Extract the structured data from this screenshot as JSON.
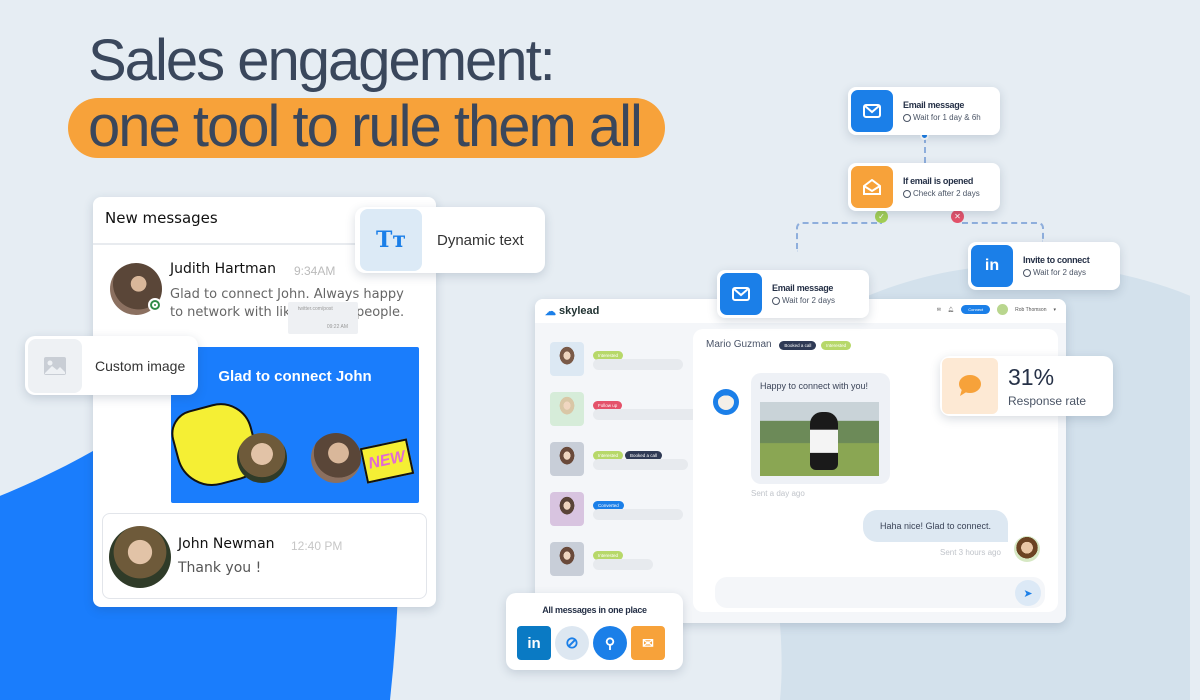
{
  "hero": {
    "line1": "Sales engagement:",
    "line2": "one tool to rule them all"
  },
  "colors": {
    "accent_blue": "#1b7fe8",
    "accent_orange": "#f7a23a",
    "interested": "#b7d86a",
    "follow_up": "#e4526a",
    "booked": "#2f3a55",
    "converted": "#1b7fe8"
  },
  "new_messages": {
    "title": "New messages",
    "message1": {
      "name": "Judith Hartman",
      "time": "9:34AM",
      "text": "Glad to connect John. Always happy to network with like-minded people."
    },
    "tooltip": {
      "line1": "twitter.com/post",
      "line2": "09:22 AM"
    },
    "image_card": {
      "text": "Glad to connect John",
      "sticker": "NEW"
    },
    "message2": {
      "name": "John Newman",
      "time": "12:40 PM",
      "text": "Thank you !"
    }
  },
  "features": {
    "dynamic_text": {
      "icon": "text-format-icon",
      "glyph": "Tт",
      "label": "Dynamic text"
    },
    "custom_image": {
      "icon": "image-icon",
      "label": "Custom image"
    }
  },
  "workflow": [
    {
      "title": "Email message",
      "sub": "Wait for 1 day & 6h",
      "icon": "envelope-icon"
    },
    {
      "title": "If email is opened",
      "sub": "Check after 2 days",
      "icon": "open-envelope-icon"
    },
    {
      "title": "Email message",
      "sub": "Wait for 2 days",
      "icon": "envelope-icon"
    },
    {
      "title": "Invite to connect",
      "sub": "Wait for 2 days",
      "icon": "linkedin-icon"
    }
  ],
  "app": {
    "logo": "skylead",
    "connect_label": "Connect",
    "user": "Rob Thomson",
    "contacts": [
      {
        "tags": [
          {
            "label": "Interested",
            "type": "interested"
          }
        ]
      },
      {
        "tags": [
          {
            "label": "Follow up",
            "type": "follow_up"
          }
        ]
      },
      {
        "tags": [
          {
            "label": "Interested",
            "type": "interested"
          },
          {
            "label": "Booked a call",
            "type": "booked"
          }
        ]
      },
      {
        "tags": [
          {
            "label": "Converted",
            "type": "converted"
          }
        ]
      },
      {
        "tags": [
          {
            "label": "Interested",
            "type": "interested"
          }
        ]
      }
    ],
    "chat": {
      "contact_name": "Mario Guzman",
      "tags": [
        {
          "label": "Booked a call",
          "type": "booked"
        },
        {
          "label": "Interested",
          "type": "interested"
        }
      ],
      "incoming": {
        "text": "Happy to connect with you!",
        "meta": "Sent a day ago"
      },
      "outgoing": {
        "text": "Haha nice! Glad to connect.",
        "meta": "Sent 3 hours ago"
      },
      "input_placeholder": ""
    }
  },
  "response_rate": {
    "value": "31%",
    "label": "Response rate"
  },
  "all_messages": {
    "title": "All messages in one place",
    "channels": [
      "linkedin",
      "compass",
      "search-user",
      "email"
    ]
  }
}
